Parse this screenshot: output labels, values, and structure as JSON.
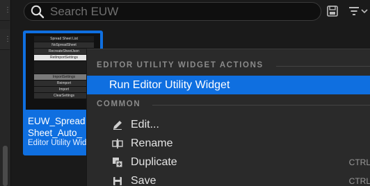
{
  "search": {
    "placeholder": "Search EUW"
  },
  "asset": {
    "name": "EUW_Spread Sheet_Auto_",
    "name_line1": "EUW_Spread",
    "name_line2": "Sheet_Auto_",
    "type": "Editor Utility Widget",
    "thumbnail_rows": [
      "Spread Sheet List",
      "NoSpreadSheet",
      "RecreateSheetJson",
      "RetImportSettings",
      "ImportSettings",
      "Reimport",
      "Import",
      "ClearSettings"
    ]
  },
  "context_menu": {
    "section1_header": "EDITOR UTILITY WIDGET ACTIONS",
    "section2_header": "COMMON",
    "items": [
      {
        "label": "Run Editor Utility Widget",
        "icon": "none",
        "shortcut": ""
      },
      {
        "label": "Edit...",
        "icon": "pencil-icon",
        "shortcut": ""
      },
      {
        "label": "Rename",
        "icon": "rename-icon",
        "shortcut": ""
      },
      {
        "label": "Duplicate",
        "icon": "duplicate-icon",
        "shortcut": "CTRL"
      },
      {
        "label": "Save",
        "icon": "save-icon",
        "shortcut": "CTRL"
      }
    ]
  },
  "colors": {
    "accent": "#0f6fe0",
    "menu_bg": "#2a2a2a",
    "background": "#1a1a1a"
  }
}
